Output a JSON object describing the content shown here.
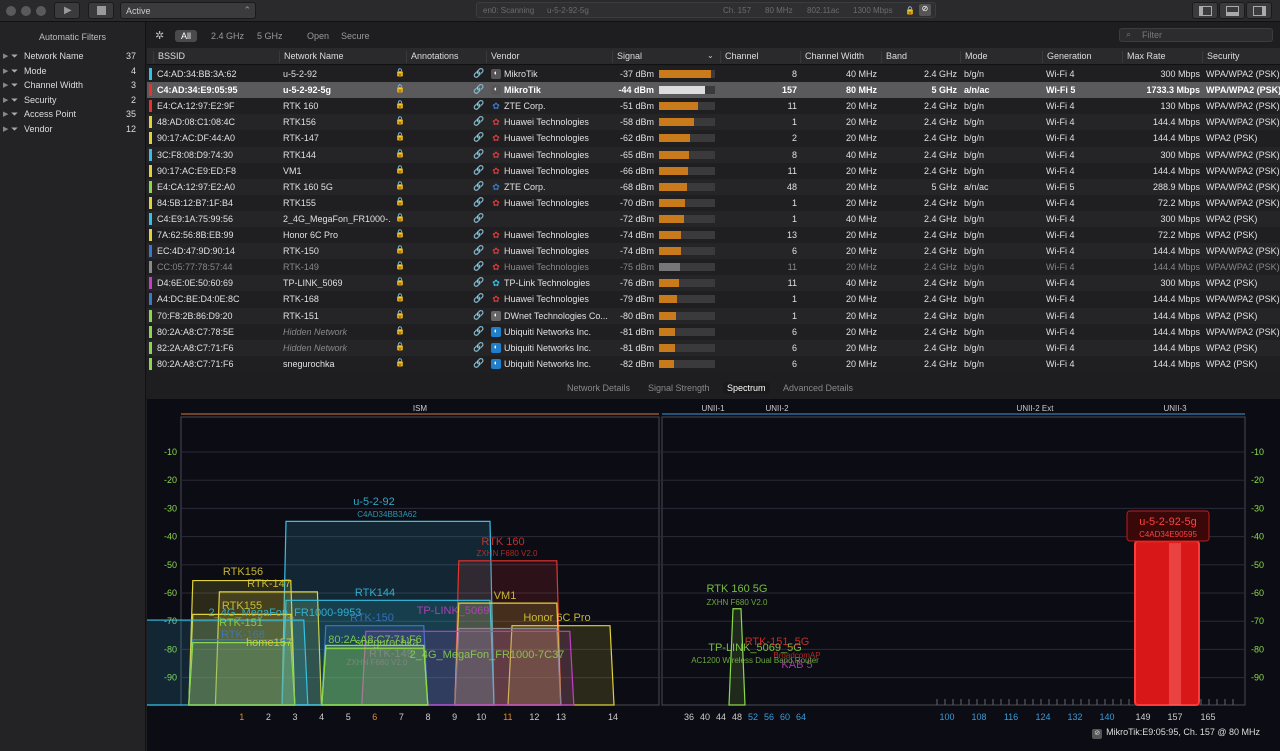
{
  "toolbar": {
    "interface_state": "Active",
    "status": {
      "scan": "en0: Scanning",
      "network": "u-5-2-92-5g",
      "channel": "Ch. 157",
      "width": "80 MHz",
      "mode": "802.11ac",
      "rate": "1300 Mbps"
    }
  },
  "sidebar": {
    "title": "Automatic Filters",
    "filters": [
      {
        "label": "Network Name",
        "count": "37"
      },
      {
        "label": "Mode",
        "count": "4"
      },
      {
        "label": "Channel Width",
        "count": "3"
      },
      {
        "label": "Security",
        "count": "2"
      },
      {
        "label": "Access Point",
        "count": "35"
      },
      {
        "label": "Vendor",
        "count": "12"
      }
    ]
  },
  "filterbar": {
    "tabs": [
      "All",
      "2.4 GHz",
      "5 GHz",
      "Open",
      "Secure"
    ],
    "search_placeholder": "Filter"
  },
  "table": {
    "columns": [
      "BSSID",
      "Network Name",
      "Annotations",
      "Vendor",
      "Signal",
      "Channel",
      "Channel Width",
      "Band",
      "Mode",
      "Generation",
      "Max Rate",
      "Security"
    ],
    "rows": [
      {
        "color": "#35c1e6",
        "bssid": "C4:AD:34:BB:3A:62",
        "name": "u-5-2-92",
        "vendor": "MikroTik",
        "vcolor": "#ffffff",
        "vbg": "#555",
        "signal": "-37 dBm",
        "pct": 0.93,
        "channel": "8",
        "width": "40 MHz",
        "band": "2.4 GHz",
        "mode": "b/g/n",
        "gen": "Wi-Fi 4",
        "rate": "300 Mbps",
        "sec": "WPA/WPA2 (PSK)"
      },
      {
        "color": "#e5342e",
        "bssid": "C4:AD:34:E9:05:95",
        "name": "u-5-2-92-5g",
        "vendor": "MikroTik",
        "vcolor": "#ffffff",
        "vbg": "#555",
        "signal": "-44 dBm",
        "pct": 0.82,
        "channel": "157",
        "width": "80 MHz",
        "band": "5 GHz",
        "mode": "a/n/ac",
        "gen": "Wi-Fi 5",
        "rate": "1733.3 Mbps",
        "sec": "WPA/WPA2 (PSK)",
        "selected": true
      },
      {
        "color": "#e5342e",
        "bssid": "E4:CA:12:97:E2:9F",
        "name": "RTK 160",
        "vendor": "ZTE Corp.",
        "vcolor": "#3a78c9",
        "vbg": "none",
        "signal": "-51 dBm",
        "pct": 0.7,
        "channel": "11",
        "width": "20 MHz",
        "band": "2.4 GHz",
        "mode": "b/g/n",
        "gen": "Wi-Fi 4",
        "rate": "130 Mbps",
        "sec": "WPA/WPA2 (PSK)"
      },
      {
        "color": "#e0d23a",
        "bssid": "48:AD:08:C1:08:4C",
        "name": "RTK156",
        "vendor": "Huawei Technologies",
        "vcolor": "#d63c3c",
        "vbg": "none",
        "signal": "-58 dBm",
        "pct": 0.62,
        "channel": "1",
        "width": "20 MHz",
        "band": "2.4 GHz",
        "mode": "b/g/n",
        "gen": "Wi-Fi 4",
        "rate": "144.4 Mbps",
        "sec": "WPA/WPA2 (PSK)"
      },
      {
        "color": "#e0d23a",
        "bssid": "90:17:AC:DF:44:A0",
        "name": "RTK-147",
        "vendor": "Huawei Technologies",
        "vcolor": "#d63c3c",
        "vbg": "none",
        "signal": "-62 dBm",
        "pct": 0.56,
        "channel": "2",
        "width": "20 MHz",
        "band": "2.4 GHz",
        "mode": "b/g/n",
        "gen": "Wi-Fi 4",
        "rate": "144.4 Mbps",
        "sec": "WPA2 (PSK)"
      },
      {
        "color": "#35c1e6",
        "bssid": "3C:F8:08:D9:74:30",
        "name": "RTK144",
        "vendor": "Huawei Technologies",
        "vcolor": "#d63c3c",
        "vbg": "none",
        "signal": "-65 dBm",
        "pct": 0.54,
        "channel": "8",
        "width": "40 MHz",
        "band": "2.4 GHz",
        "mode": "b/g/n",
        "gen": "Wi-Fi 4",
        "rate": "300 Mbps",
        "sec": "WPA/WPA2 (PSK)"
      },
      {
        "color": "#e0d23a",
        "bssid": "90:17:AC:E9:ED:F8",
        "name": "VM1",
        "vendor": "Huawei Technologies",
        "vcolor": "#d63c3c",
        "vbg": "none",
        "signal": "-66 dBm",
        "pct": 0.52,
        "channel": "11",
        "width": "20 MHz",
        "band": "2.4 GHz",
        "mode": "b/g/n",
        "gen": "Wi-Fi 4",
        "rate": "144.4 Mbps",
        "sec": "WPA/WPA2 (PSK)"
      },
      {
        "color": "#8bd94a",
        "bssid": "E4:CA:12:97:E2:A0",
        "name": "RTK 160 5G",
        "vendor": "ZTE Corp.",
        "vcolor": "#3a78c9",
        "vbg": "none",
        "signal": "-68 dBm",
        "pct": 0.5,
        "channel": "48",
        "width": "20 MHz",
        "band": "5 GHz",
        "mode": "a/n/ac",
        "gen": "Wi-Fi 5",
        "rate": "288.9 Mbps",
        "sec": "WPA/WPA2 (PSK)"
      },
      {
        "color": "#e0d23a",
        "bssid": "84:5B:12:B7:1F:B4",
        "name": "RTK155",
        "vendor": "Huawei Technologies",
        "vcolor": "#d63c3c",
        "vbg": "none",
        "signal": "-70 dBm",
        "pct": 0.46,
        "channel": "1",
        "width": "20 MHz",
        "band": "2.4 GHz",
        "mode": "b/g/n",
        "gen": "Wi-Fi 4",
        "rate": "72.2 Mbps",
        "sec": "WPA/WPA2 (PSK)"
      },
      {
        "color": "#35c1e6",
        "bssid": "C4:E9:1A:75:99:56",
        "name": "2_4G_MegaFon_FR1000-...",
        "vendor": "",
        "vcolor": "#ffffff",
        "vbg": "none",
        "signal": "-72 dBm",
        "pct": 0.44,
        "channel": "1",
        "width": "40 MHz",
        "band": "2.4 GHz",
        "mode": "b/g/n",
        "gen": "Wi-Fi 4",
        "rate": "300 Mbps",
        "sec": "WPA2 (PSK)"
      },
      {
        "color": "#e0d23a",
        "bssid": "7A:62:56:8B:EB:99",
        "name": "Honor 6C Pro",
        "vendor": "Huawei Technologies",
        "vcolor": "#d63c3c",
        "vbg": "none",
        "signal": "-74 dBm",
        "pct": 0.4,
        "channel": "13",
        "width": "20 MHz",
        "band": "2.4 GHz",
        "mode": "b/g/n",
        "gen": "Wi-Fi 4",
        "rate": "72.2 Mbps",
        "sec": "WPA2 (PSK)"
      },
      {
        "color": "#3a78c9",
        "bssid": "EC:4D:47:9D:90:14",
        "name": "RTK-150",
        "vendor": "Huawei Technologies",
        "vcolor": "#d63c3c",
        "vbg": "none",
        "signal": "-74 dBm",
        "pct": 0.4,
        "channel": "6",
        "width": "20 MHz",
        "band": "2.4 GHz",
        "mode": "b/g/n",
        "gen": "Wi-Fi 4",
        "rate": "144.4 Mbps",
        "sec": "WPA/WPA2 (PSK)"
      },
      {
        "color": "#8a8a8a",
        "bssid": "CC:05:77:78:57:44",
        "name": "RTK-149",
        "vendor": "Huawei Technologies",
        "vcolor": "#d63c3c",
        "vbg": "none",
        "signal": "-75 dBm",
        "pct": 0.38,
        "channel": "11",
        "width": "20 MHz",
        "band": "2.4 GHz",
        "mode": "b/g/n",
        "gen": "Wi-Fi 4",
        "rate": "144.4 Mbps",
        "sec": "WPA/WPA2 (PSK)",
        "dim": true
      },
      {
        "color": "#c43ec9",
        "bssid": "D4:6E:0E:50:60:69",
        "name": "TP-LINK_5069",
        "vendor": "TP-Link Technologies",
        "vcolor": "#35c1e6",
        "vbg": "none",
        "signal": "-76 dBm",
        "pct": 0.36,
        "channel": "11",
        "width": "40 MHz",
        "band": "2.4 GHz",
        "mode": "b/g/n",
        "gen": "Wi-Fi 4",
        "rate": "300 Mbps",
        "sec": "WPA2 (PSK)"
      },
      {
        "color": "#3a78c9",
        "bssid": "A4:DC:BE:D4:0E:8C",
        "name": "RTK-168",
        "vendor": "Huawei Technologies",
        "vcolor": "#d63c3c",
        "vbg": "none",
        "signal": "-79 dBm",
        "pct": 0.32,
        "channel": "1",
        "width": "20 MHz",
        "band": "2.4 GHz",
        "mode": "b/g/n",
        "gen": "Wi-Fi 4",
        "rate": "144.4 Mbps",
        "sec": "WPA/WPA2 (PSK)"
      },
      {
        "color": "#8bd94a",
        "bssid": "70:F8:2B:86:D9:20",
        "name": "RTK-151",
        "vendor": "DWnet Technologies Co...",
        "vcolor": "#ffffff",
        "vbg": "#666",
        "signal": "-80 dBm",
        "pct": 0.3,
        "channel": "1",
        "width": "20 MHz",
        "band": "2.4 GHz",
        "mode": "b/g/n",
        "gen": "Wi-Fi 4",
        "rate": "144.4 Mbps",
        "sec": "WPA2 (PSK)"
      },
      {
        "color": "#8bd94a",
        "bssid": "80:2A:A8:C7:78:5E",
        "name": "Hidden Network",
        "hidden": true,
        "vendor": "Ubiquiti Networks Inc.",
        "vcolor": "#ffffff",
        "vbg": "#1f7fc9",
        "signal": "-81 dBm",
        "pct": 0.28,
        "channel": "6",
        "width": "20 MHz",
        "band": "2.4 GHz",
        "mode": "b/g/n",
        "gen": "Wi-Fi 4",
        "rate": "144.4 Mbps",
        "sec": "WPA/WPA2 (PSK)"
      },
      {
        "color": "#8bd94a",
        "bssid": "82:2A:A8:C7:71:F6",
        "name": "Hidden Network",
        "hidden": true,
        "vendor": "Ubiquiti Networks Inc.",
        "vcolor": "#ffffff",
        "vbg": "#1f7fc9",
        "signal": "-81 dBm",
        "pct": 0.28,
        "channel": "6",
        "width": "20 MHz",
        "band": "2.4 GHz",
        "mode": "b/g/n",
        "gen": "Wi-Fi 4",
        "rate": "144.4 Mbps",
        "sec": "WPA2 (PSK)"
      },
      {
        "color": "#8bd94a",
        "bssid": "80:2A:A8:C7:71:F6",
        "name": "snegurochka",
        "vendor": "Ubiquiti Networks Inc.",
        "vcolor": "#ffffff",
        "vbg": "#1f7fc9",
        "signal": "-82 dBm",
        "pct": 0.26,
        "channel": "6",
        "width": "20 MHz",
        "band": "2.4 GHz",
        "mode": "b/g/n",
        "gen": "Wi-Fi 4",
        "rate": "144.4 Mbps",
        "sec": "WPA2 (PSK)"
      }
    ]
  },
  "bottom_tabs": [
    "Network Details",
    "Signal Strength",
    "Spectrum",
    "Advanced Details"
  ],
  "spectrum": {
    "bands": {
      "ism": "ISM",
      "unii1": "UNII-1",
      "unii2": "UNII-2",
      "unii2ext": "UNII-2 Ext",
      "unii3": "UNII-3"
    },
    "y_ticks": [
      "-10",
      "-20",
      "-30",
      "-40",
      "-50",
      "-60",
      "-70",
      "-80",
      "-90"
    ],
    "ch24": [
      "1",
      "2",
      "3",
      "4",
      "5",
      "6",
      "7",
      "8",
      "9",
      "10",
      "11",
      "12",
      "13",
      "14"
    ],
    "ch5_low": [
      "36",
      "40",
      "44",
      "48",
      "52",
      "56",
      "60",
      "64"
    ],
    "ch5_high": [
      "100",
      "108",
      "116",
      "124",
      "132",
      "140",
      "149",
      "157",
      "165"
    ],
    "selected_label": "u-5-2-92-5g",
    "selected_sub": "C4AD34E90595",
    "footer": "MikroTik:E9:05:95, Ch. 157 @ 80 MHz",
    "labels": [
      {
        "t": "u-5-2-92",
        "s": "C4AD34BB3A62",
        "c": "#35c1e6"
      },
      {
        "t": "RTK 160",
        "s": "ZXHN F680 V2.0",
        "c": "#e5342e"
      },
      {
        "t": "RTK156",
        "c": "#e0d23a"
      },
      {
        "t": "RTK-147",
        "c": "#e0d23a"
      },
      {
        "t": "RTK144",
        "c": "#35c1e6"
      },
      {
        "t": "VM1",
        "c": "#e0d23a"
      },
      {
        "t": "Honor 6C Pro",
        "c": "#e0d23a"
      },
      {
        "t": "RTK155",
        "c": "#e0d23a"
      },
      {
        "t": "2_4G_MegaFon_FR1000-9953",
        "c": "#35c1e6"
      },
      {
        "t": "RTK-150",
        "c": "#3a78c9"
      },
      {
        "t": "TP-LINK_5069",
        "s": "AC1200 Wireless Dual Band Router",
        "c": "#c43ec9"
      },
      {
        "t": "RTK-151",
        "c": "#8bd94a"
      },
      {
        "t": "RTK-168",
        "c": "#3a78c9"
      },
      {
        "t": "home157",
        "c": "#e0d23a"
      },
      {
        "t": "80:2A:A8:C7:71:F6",
        "c": "#8bd94a"
      },
      {
        "t": "snegurochka",
        "c": "#8bd94a"
      },
      {
        "t": "RTK-149",
        "s": "ZXHN F680 V2.0",
        "c": "#8a8a8a"
      },
      {
        "t": "2_4G_MegaFon_FR1000-7C37",
        "c": "#8bd94a"
      },
      {
        "t": "RTK 160 5G",
        "s": "ZXHN F680 V2.0",
        "c": "#8bd94a"
      },
      {
        "t": "TP-LINK_5069_5G",
        "s": "AC1200 Wireless Dual Band Router",
        "c": "#8bd94a"
      },
      {
        "t": "RTK-151_5G",
        "s": "BroadcomAP",
        "c": "#e5342e"
      },
      {
        "t": "KAB 5",
        "c": "#c43ec9"
      }
    ]
  }
}
